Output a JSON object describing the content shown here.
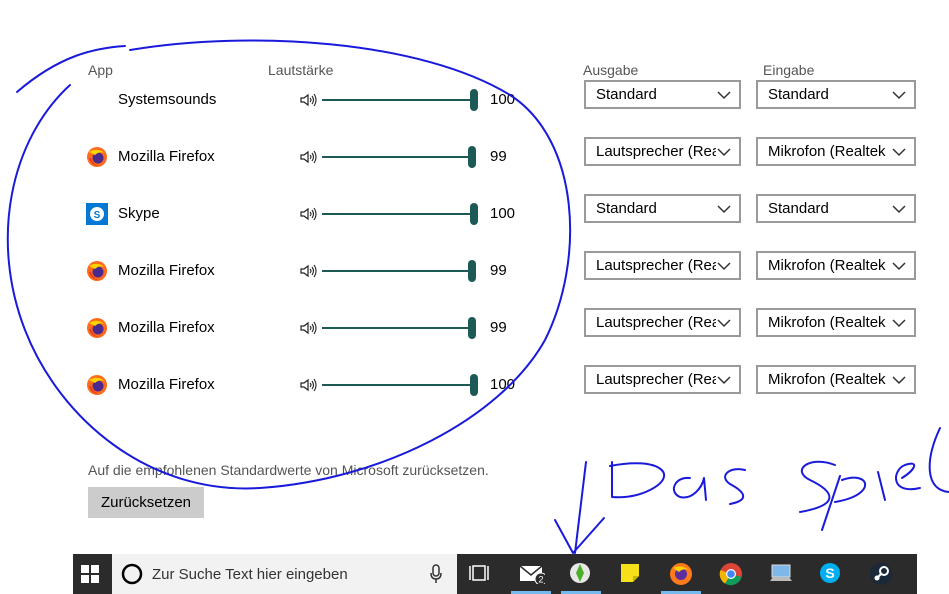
{
  "headers": {
    "app": "App",
    "volume": "Lautstärke",
    "output": "Ausgabe",
    "input": "Eingabe"
  },
  "rows": [
    {
      "app": "Systemsounds",
      "icon": "none",
      "volume": "100",
      "level": 100,
      "output": "Standard",
      "input": "Standard"
    },
    {
      "app": "Mozilla Firefox",
      "icon": "firefox-icon",
      "volume": "99",
      "level": 99,
      "output": "Lautsprecher (Realtek",
      "input": "Mikrofon (Realtek"
    },
    {
      "app": "Skype",
      "icon": "skype-icon",
      "volume": "100",
      "level": 100,
      "output": "Standard",
      "input": "Standard"
    },
    {
      "app": "Mozilla Firefox",
      "icon": "firefox-icon",
      "volume": "99",
      "level": 99,
      "output": "Lautsprecher (Realtek",
      "input": "Mikrofon (Realtek"
    },
    {
      "app": "Mozilla Firefox",
      "icon": "firefox-icon",
      "volume": "99",
      "level": 99,
      "output": "Lautsprecher (Realtek",
      "input": "Mikrofon (Realtek"
    },
    {
      "app": "Mozilla Firefox",
      "icon": "firefox-icon",
      "volume": "100",
      "level": 100,
      "output": "Lautsprecher (Realtek",
      "input": "Mikrofon (Realtek"
    }
  ],
  "reset": {
    "text": "Auf die empfohlenen Standardwerte von Microsoft zurücksetzen.",
    "button": "Zurücksetzen"
  },
  "taskbar": {
    "search_placeholder": "Zur Suche Text hier eingeben",
    "mail_badge": "2",
    "icons": [
      "windows-start-icon",
      "cortana-icon",
      "microphone-icon",
      "task-view-icon",
      "mail-icon",
      "sims-icon",
      "sticky-notes-icon",
      "firefox-icon",
      "chrome-icon",
      "desktop-icon",
      "skype-icon",
      "steam-icon"
    ]
  },
  "annotation": {
    "handwritten": "Das Spiel"
  },
  "colors": {
    "slider": "#1e5a55",
    "ink": "#1a1adb",
    "taskbar": "#2b2b2b",
    "accent": "#76b9ed"
  }
}
